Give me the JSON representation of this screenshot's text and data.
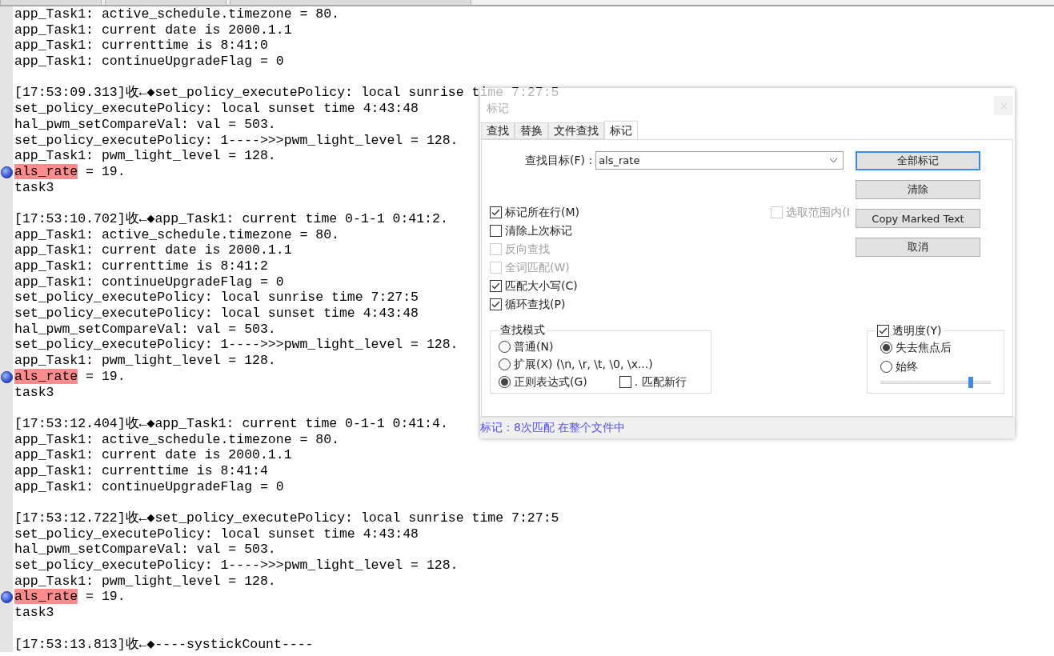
{
  "editor": {
    "lines": [
      {
        "kind": "text",
        "text": "app_Task1: active_schedule.timezone = 80."
      },
      {
        "kind": "text",
        "text": "app_Task1: current date is 2000.1.1"
      },
      {
        "kind": "text",
        "text": "app_Task1: currenttime is 8:41:0"
      },
      {
        "kind": "text",
        "text": "app_Task1: continueUpgradeFlag = 0"
      },
      {
        "kind": "blank"
      },
      {
        "kind": "text",
        "text": "[17:53:09.313]收←◆set_policy_executePolicy: local sunrise time 7:27:5"
      },
      {
        "kind": "text",
        "text": "set_policy_executePolicy: local sunset time 4:43:48"
      },
      {
        "kind": "text",
        "text": "hal_pwm_setCompareVal: val = 503."
      },
      {
        "kind": "text",
        "text": "set_policy_executePolicy: 1---->>>pwm_light_level = 128."
      },
      {
        "kind": "text",
        "text": "app_Task1: pwm_light_level = 128."
      },
      {
        "kind": "marked",
        "highlight": "als_rate",
        "text": " = 19."
      },
      {
        "kind": "text",
        "text": "task3"
      },
      {
        "kind": "blank"
      },
      {
        "kind": "text",
        "text": "[17:53:10.702]收←◆app_Task1: current time 0-1-1 0:41:2."
      },
      {
        "kind": "text",
        "text": "app_Task1: active_schedule.timezone = 80."
      },
      {
        "kind": "text",
        "text": "app_Task1: current date is 2000.1.1"
      },
      {
        "kind": "text",
        "text": "app_Task1: currenttime is 8:41:2"
      },
      {
        "kind": "text",
        "text": "app_Task1: continueUpgradeFlag = 0"
      },
      {
        "kind": "text",
        "text": "set_policy_executePolicy: local sunrise time 7:27:5"
      },
      {
        "kind": "text",
        "text": "set_policy_executePolicy: local sunset time 4:43:48"
      },
      {
        "kind": "text",
        "text": "hal_pwm_setCompareVal: val = 503."
      },
      {
        "kind": "text",
        "text": "set_policy_executePolicy: 1---->>>pwm_light_level = 128."
      },
      {
        "kind": "text",
        "text": "app_Task1: pwm_light_level = 128."
      },
      {
        "kind": "marked",
        "highlight": "als_rate",
        "text": " = 19."
      },
      {
        "kind": "text",
        "text": "task3"
      },
      {
        "kind": "blank"
      },
      {
        "kind": "text",
        "text": "[17:53:12.404]收←◆app_Task1: current time 0-1-1 0:41:4."
      },
      {
        "kind": "text",
        "text": "app_Task1: active_schedule.timezone = 80."
      },
      {
        "kind": "text",
        "text": "app_Task1: current date is 2000.1.1"
      },
      {
        "kind": "text",
        "text": "app_Task1: currenttime is 8:41:4"
      },
      {
        "kind": "text",
        "text": "app_Task1: continueUpgradeFlag = 0"
      },
      {
        "kind": "blank"
      },
      {
        "kind": "text",
        "text": "[17:53:12.722]收←◆set_policy_executePolicy: local sunrise time 7:27:5"
      },
      {
        "kind": "text",
        "text": "set_policy_executePolicy: local sunset time 4:43:48"
      },
      {
        "kind": "text",
        "text": "hal_pwm_setCompareVal: val = 503."
      },
      {
        "kind": "text",
        "text": "set_policy_executePolicy: 1---->>>pwm_light_level = 128."
      },
      {
        "kind": "text",
        "text": "app_Task1: pwm_light_level = 128."
      },
      {
        "kind": "marked",
        "highlight": "als_rate",
        "text": " = 19."
      },
      {
        "kind": "text",
        "text": "task3"
      },
      {
        "kind": "blank"
      },
      {
        "kind": "text",
        "text": "[17:53:13.813]收←◆----systickCount----"
      }
    ]
  },
  "dialog": {
    "title": "标记",
    "tabs": [
      {
        "label": "查找",
        "selected": false
      },
      {
        "label": "替换",
        "selected": false
      },
      {
        "label": "文件查找",
        "selected": false
      },
      {
        "label": "标记",
        "selected": true
      }
    ],
    "find_target": {
      "label": "查找目标(F) :",
      "value": "als_rate"
    },
    "buttons": [
      {
        "label": "全部标记",
        "focused": true
      },
      {
        "label": "清除",
        "focused": false
      },
      {
        "label": "Copy Marked Text",
        "focused": false
      },
      {
        "label": "取消",
        "focused": false
      }
    ],
    "options": [
      {
        "label": "标记所在行(M)",
        "checked": true,
        "disabled": false
      },
      {
        "label": "清除上次标记",
        "checked": false,
        "disabled": false
      },
      {
        "label": "反向查找",
        "checked": false,
        "disabled": true
      },
      {
        "label": "全词匹配(W)",
        "checked": false,
        "disabled": true
      },
      {
        "label": "匹配大小写(C)",
        "checked": true,
        "disabled": false
      },
      {
        "label": "循环查找(P)",
        "checked": true,
        "disabled": false
      }
    ],
    "in_selection": {
      "label": "选取范围内(I",
      "checked": false,
      "disabled": true
    },
    "search_mode": {
      "title": "查找模式",
      "options": [
        {
          "label": "普通(N)",
          "selected": false
        },
        {
          "label": "扩展(X) (\\n, \\r, \\t, \\0, \\x...)",
          "selected": false
        },
        {
          "label": "正则表达式(G)",
          "selected": true
        }
      ],
      "dot_newline": {
        "label": ". 匹配新行",
        "checked": false
      }
    },
    "transparency": {
      "label": "透明度(Y)",
      "checked": true,
      "options": [
        {
          "label": "失去焦点后",
          "selected": true
        },
        {
          "label": "始终",
          "selected": false
        }
      ],
      "level": 0.82
    },
    "status": "标记：8次匹配 在整个文件中"
  }
}
